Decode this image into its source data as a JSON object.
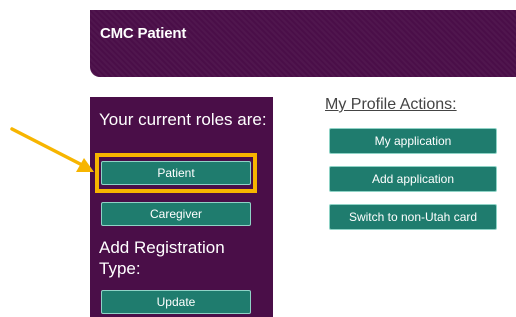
{
  "header": {
    "title": "CMC Patient"
  },
  "roles": {
    "heading": "Your current roles are:",
    "patient_label": "Patient",
    "caregiver_label": "Caregiver"
  },
  "registration": {
    "heading": "Add Registration Type:",
    "update_label": "Update"
  },
  "profile_actions": {
    "title": "My Profile Actions:",
    "my_application_label": "My application",
    "add_application_label": "Add application",
    "switch_card_label": "Switch to non-Utah card"
  },
  "colors": {
    "header_bg": "#4a0e48",
    "button_bg": "#1f7c6e",
    "highlight": "#f7b500"
  },
  "annotations": {
    "arrow_icon": "arrow-pointing-right",
    "highlighted_item": "Patient"
  }
}
